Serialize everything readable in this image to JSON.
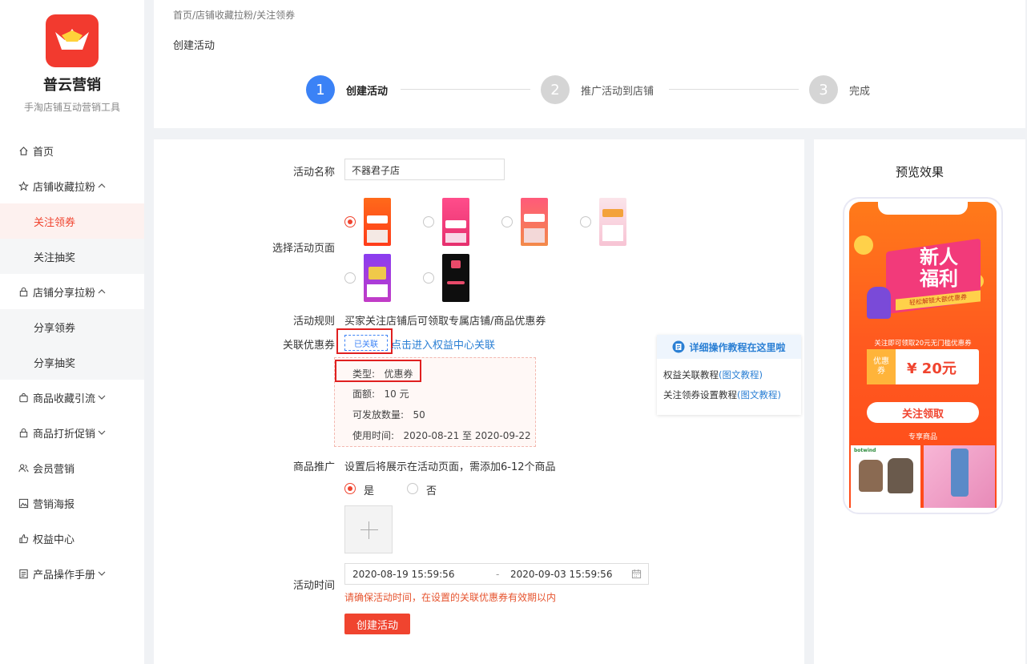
{
  "brand": {
    "name": "普云营销",
    "slogan": "手淘店铺互动营销工具"
  },
  "nav": {
    "home": "首页",
    "shop_collect": "店铺收藏拉粉",
    "follow_coupon": "关注领券",
    "follow_lottery": "关注抽奖",
    "shop_share": "店铺分享拉粉",
    "share_coupon": "分享领券",
    "share_lottery": "分享抽奖",
    "goods_collect": "商品收藏引流",
    "goods_discount": "商品打折促销",
    "member": "会员营销",
    "poster": "营销海报",
    "rights": "权益中心",
    "manual": "产品操作手册"
  },
  "breadcrumb": "首页/店铺收藏拉粉/关注领券",
  "page_title": "创建活动",
  "steps": [
    {
      "num": "1",
      "label": "创建活动"
    },
    {
      "num": "2",
      "label": "推广活动到店铺"
    },
    {
      "num": "3",
      "label": "完成"
    }
  ],
  "form": {
    "name_label": "活动名称",
    "name_value": "不器君子店",
    "page_label": "选择活动页面",
    "rules_label": "活动规则",
    "rules_value": "买家关注店铺后可领取专属店铺/商品优惠券",
    "coupon_label": "关联优惠券",
    "coupon_tag": "已关联",
    "coupon_link": "点击进入权益中心关联",
    "coupon": {
      "type_label": "类型:",
      "type_value": "优惠券",
      "amount_label": "面额:",
      "amount_value": "10 元",
      "qty_label": "可发放数量:",
      "qty_value": "50",
      "period_label": "使用时间:",
      "period_value": "2020-08-21 至 2020-09-22"
    },
    "goods_label": "商品推广",
    "goods_desc": "设置后将展示在活动页面，需添加6-12个商品",
    "yes": "是",
    "no": "否",
    "time_label": "活动时间",
    "start": "2020-08-19 15:59:56",
    "sep": "-",
    "end": "2020-09-03 15:59:56",
    "warning": "请确保活动时间，在设置的关联优惠券有效期以内",
    "submit": "创建活动"
  },
  "tutorial": {
    "title": "详细操作教程在这里啦",
    "line1": "权益关联教程",
    "line1_link": "(图文教程)",
    "line2": "关注领券设置教程",
    "line2_link": "(图文教程)"
  },
  "preview": {
    "title": "预览效果",
    "banner_line1": "新人",
    "banner_line2": "福利",
    "banner_sub": "轻松解锁大额优惠券",
    "notice": "关注即可领取20元无门槛优惠券",
    "coupon_side": "优惠券",
    "coupon_amount": "¥ 20元",
    "cta": "关注领取",
    "section": "专享商品",
    "brand_tag": "botwind"
  },
  "colors": {
    "accent": "#f0442f",
    "blue": "#3b82f6",
    "link": "#2a7fd4",
    "phone_bg": "#ff5a1f"
  }
}
